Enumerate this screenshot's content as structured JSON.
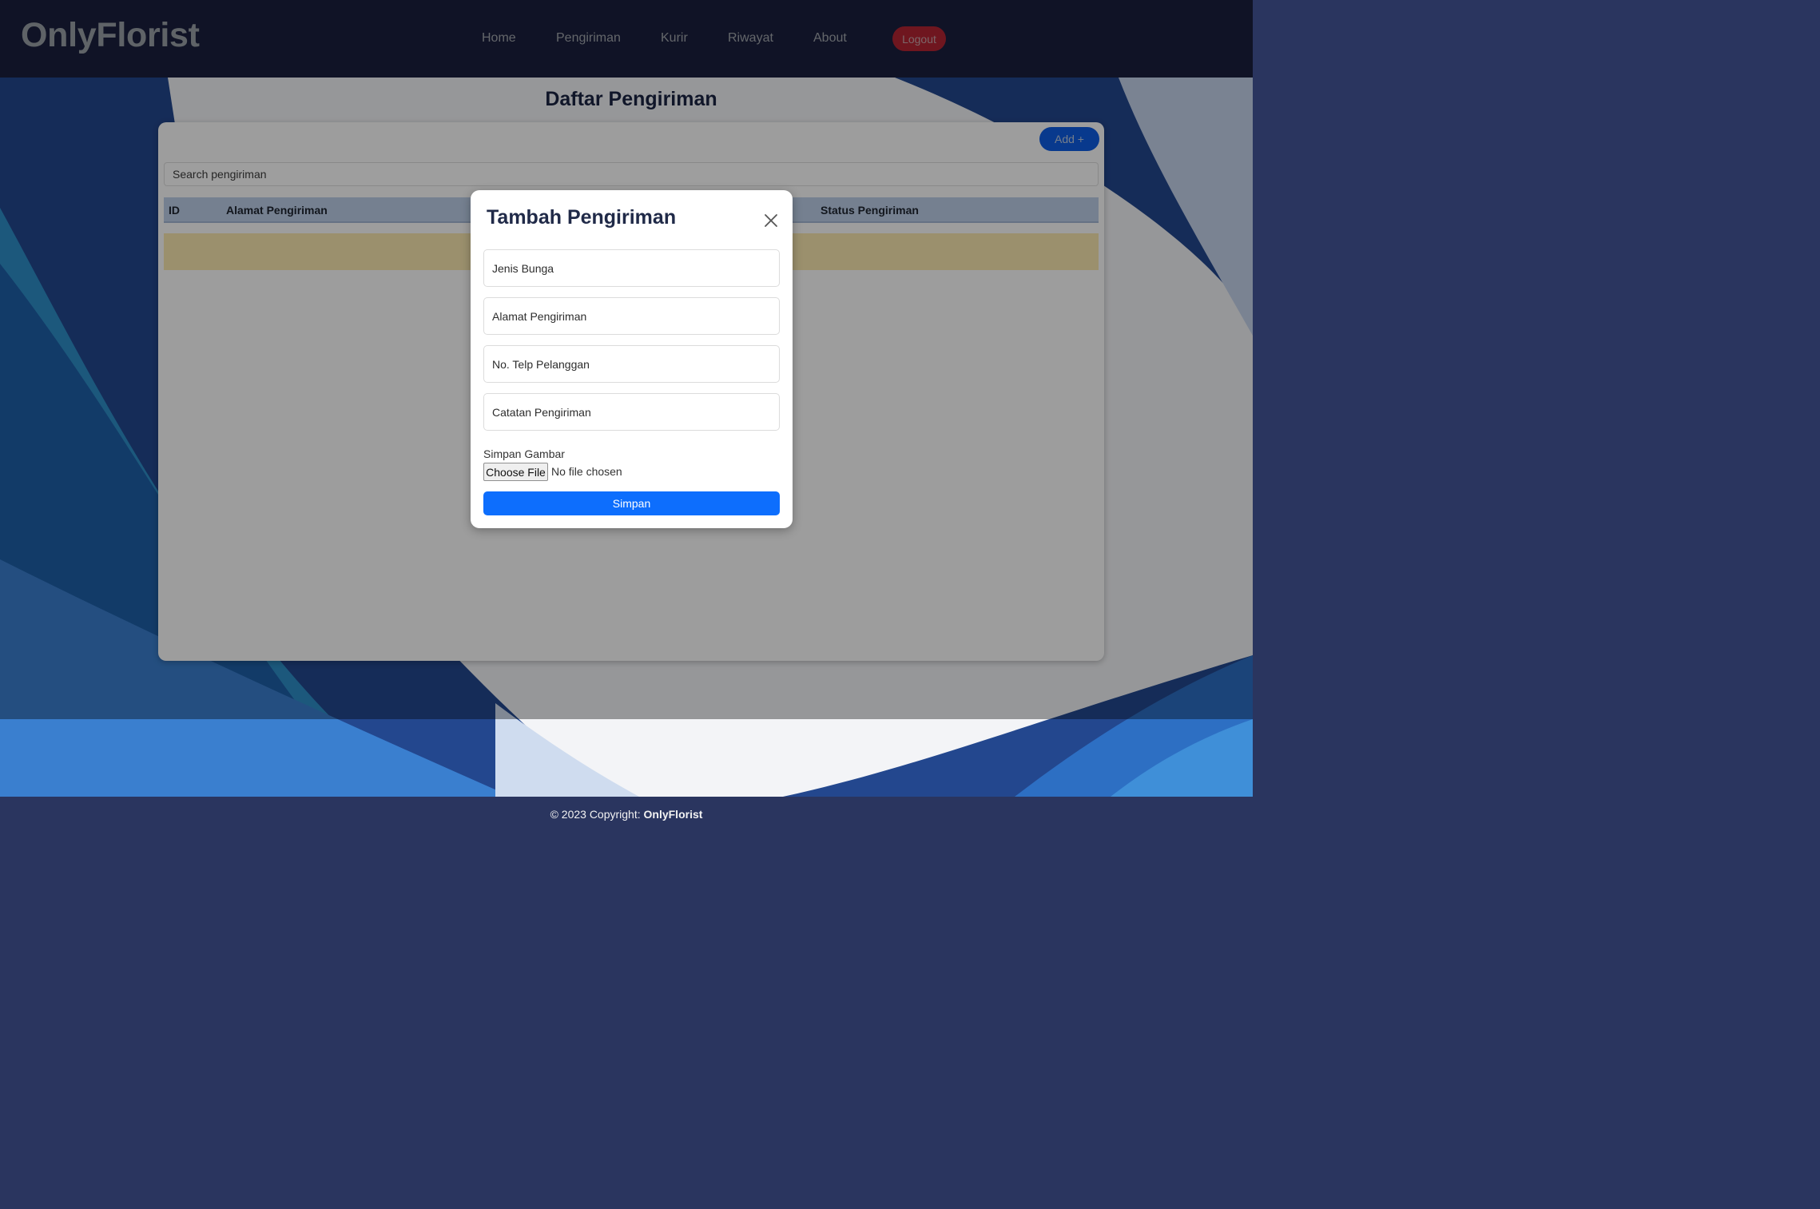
{
  "brand": "OnlyFlorist",
  "nav": {
    "home": "Home",
    "pengiriman": "Pengiriman",
    "kurir": "Kurir",
    "riwayat": "Riwayat",
    "about": "About",
    "logout": "Logout"
  },
  "page_title": "Daftar Pengiriman",
  "card": {
    "add_label": "Add +",
    "search_placeholder": "Search pengiriman",
    "columns": [
      "ID",
      "Alamat Pengiriman",
      "Status Pengiriman"
    ]
  },
  "modal": {
    "title": "Tambah Pengiriman",
    "fields": [
      "Jenis Bunga",
      "Alamat Pengiriman",
      "No. Telp Pelanggan",
      "Catatan Pengiriman"
    ],
    "file_label": "Simpan Gambar",
    "file_button": "Choose File",
    "file_status": "No file chosen",
    "save_label": "Simpan"
  },
  "footer": {
    "text": "© 2023 Copyright: ",
    "brand": "OnlyFlorist"
  },
  "colors": {
    "navbar": "#1b203e",
    "primary": "#0d6efd",
    "danger": "#b32432",
    "footer": "#2a355f"
  }
}
